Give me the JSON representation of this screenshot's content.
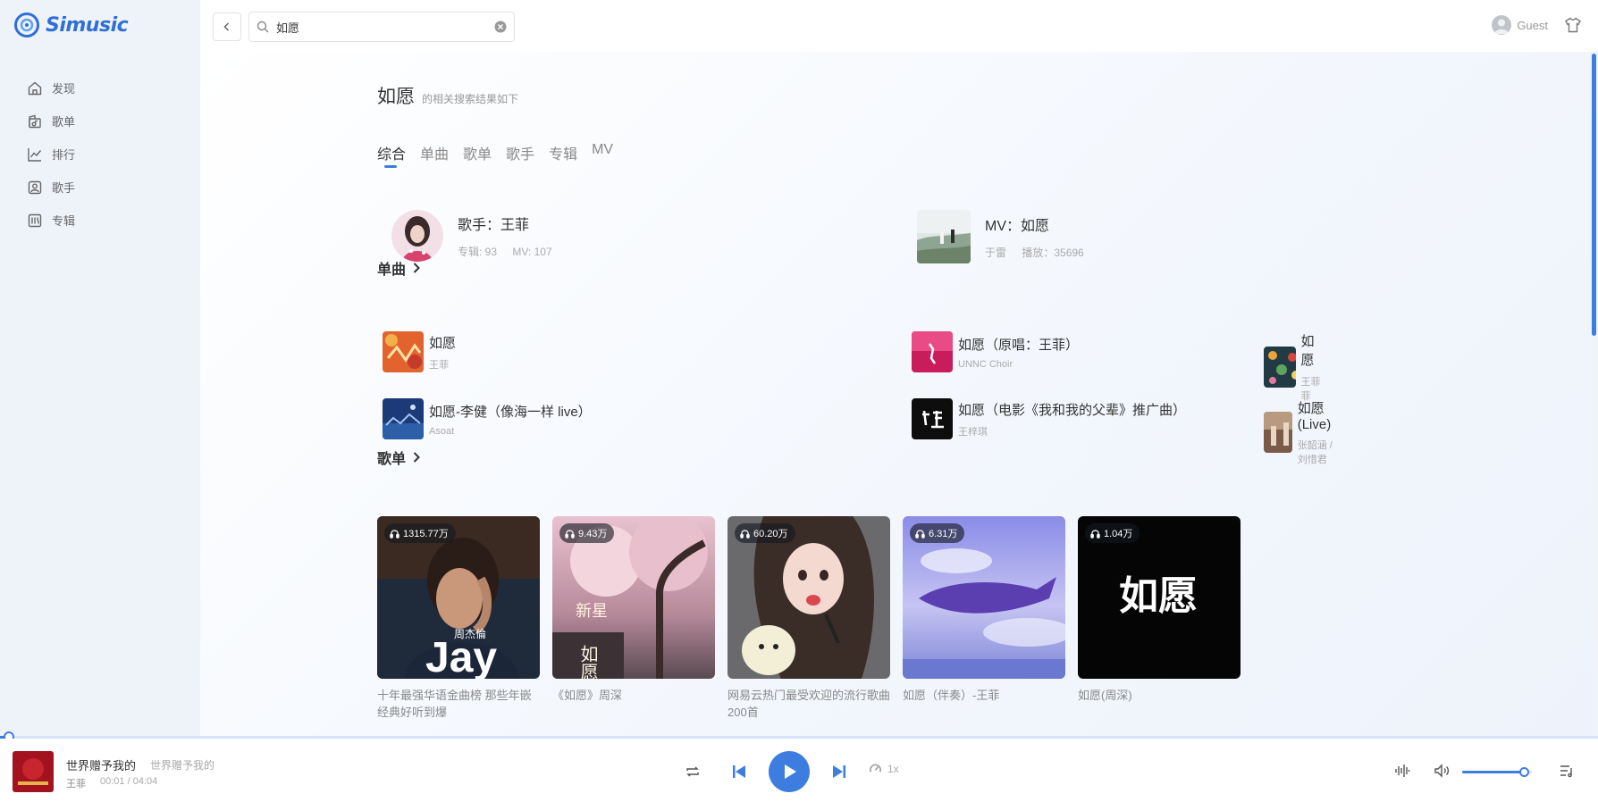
{
  "app": {
    "name": "Simusic"
  },
  "sidebar": {
    "items": [
      {
        "label": "发现",
        "icon": "home-icon"
      },
      {
        "label": "歌单",
        "icon": "playlist-icon"
      },
      {
        "label": "排行",
        "icon": "chart-icon"
      },
      {
        "label": "歌手",
        "icon": "artist-icon"
      },
      {
        "label": "专辑",
        "icon": "album-icon"
      }
    ]
  },
  "header": {
    "search_value": "如愿",
    "user_name": "Guest"
  },
  "search": {
    "keyword": "如愿",
    "hint": "的相关搜索结果如下",
    "tabs": [
      "综合",
      "单曲",
      "歌单",
      "歌手",
      "专辑",
      "MV"
    ],
    "active_tab": "综合"
  },
  "best_match": {
    "artist": {
      "title": "歌手：王菲",
      "albums": "专辑: 93",
      "mvs": "MV: 107"
    },
    "mv": {
      "title": "MV：如愿",
      "artist": "于雷",
      "plays": "播放：35696"
    }
  },
  "songs_section": {
    "title": "单曲",
    "songs": [
      {
        "name": "如愿",
        "artist": "王菲"
      },
      {
        "name": "如愿（原唱：王菲）",
        "artist": "UNNC Choir"
      },
      {
        "name": "如愿",
        "artist": "王菲菲"
      },
      {
        "name": "如愿-李健（像海一样 live）",
        "artist": "Asoat"
      },
      {
        "name": "如愿（电影《我和我的父辈》推广曲）",
        "artist": "王梓琪"
      },
      {
        "name": "如愿 (Live)",
        "artist": "张韶涵 / 刘惜君"
      }
    ]
  },
  "playlists_section": {
    "title": "歌单",
    "playlists": [
      {
        "name": "十年最强华语金曲榜 那些年嵌经典好听到爆",
        "plays": "1315.77万"
      },
      {
        "name": "《如愿》周深",
        "plays": "9.43万"
      },
      {
        "name": "网易云热门最受欢迎的流行歌曲200首",
        "plays": "60.20万"
      },
      {
        "name": "如愿（伴奏）-王菲",
        "plays": "6.31万"
      },
      {
        "name": "如愿(周深)",
        "plays": "1.04万"
      }
    ],
    "cover_text": {
      "jay": "Jay",
      "jay_small": "周杰倫",
      "ruyuan": "如愿",
      "xinxing": "新星"
    }
  },
  "player": {
    "title": "世界赠予我的",
    "subtitle": "世界赠予我的",
    "artist": "王菲",
    "time": "00:01 / 04:04",
    "speed": "1x",
    "progress": 0.004,
    "volume": 0.88,
    "accent": "#3d7de0"
  }
}
